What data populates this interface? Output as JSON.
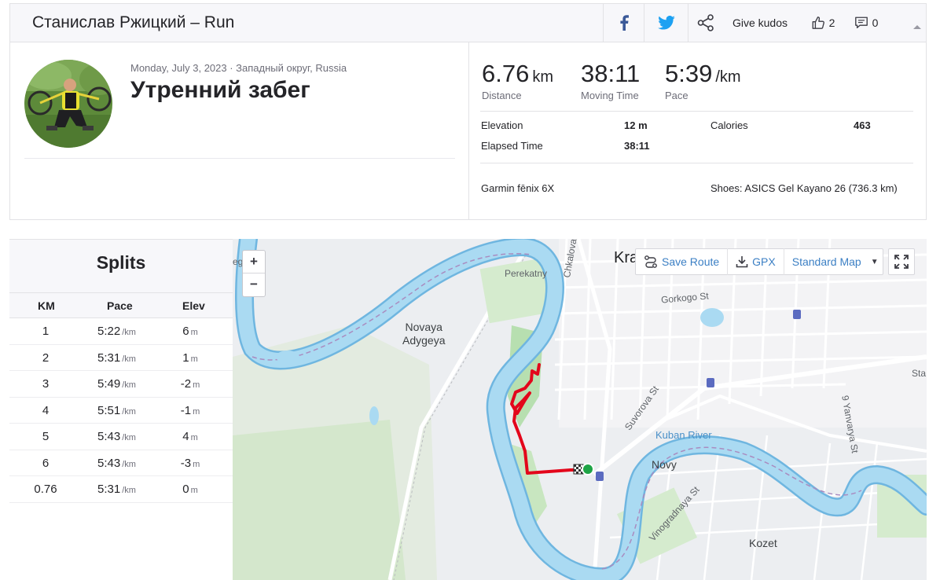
{
  "header": {
    "title": "Станислав Ржицкий – Run",
    "give_kudos": "Give kudos",
    "kudos_count": "2",
    "comments_count": "0",
    "icons": [
      "facebook-icon",
      "twitter-icon",
      "share-icon",
      "thumbs-up-icon",
      "comment-icon",
      "collapse-icon"
    ]
  },
  "activity": {
    "date_location": "Monday, July 3, 2023 · Западный округ, Russia",
    "title": "Утренний забег",
    "stats": {
      "distance": {
        "value": "6.76",
        "unit": "km",
        "label": "Distance"
      },
      "moving_time": {
        "value": "38:11",
        "label": "Moving Time"
      },
      "pace": {
        "value": "5:39",
        "unit": "/km",
        "label": "Pace"
      }
    },
    "details": {
      "elevation_label": "Elevation",
      "elevation_value": "12 m",
      "calories_label": "Calories",
      "calories_value": "463",
      "elapsed_label": "Elapsed Time",
      "elapsed_value": "38:11"
    },
    "device": "Garmin fēnix 6X",
    "shoes": "Shoes: ASICS Gel Kayano 26 (736.3 km)"
  },
  "splits": {
    "title": "Splits",
    "columns": [
      "KM",
      "Pace",
      "Elev"
    ],
    "pace_unit": "/km",
    "elev_unit": "m",
    "rows": [
      {
        "km": "1",
        "pace": "5:22",
        "elev": "6"
      },
      {
        "km": "2",
        "pace": "5:31",
        "elev": "1"
      },
      {
        "km": "3",
        "pace": "5:49",
        "elev": "-2"
      },
      {
        "km": "4",
        "pace": "5:51",
        "elev": "-1"
      },
      {
        "km": "5",
        "pace": "5:43",
        "elev": "4"
      },
      {
        "km": "6",
        "pace": "5:43",
        "elev": "-3"
      },
      {
        "km": "0.76",
        "pace": "5:31",
        "elev": "0"
      }
    ]
  },
  "map": {
    "zoom_in": "+",
    "zoom_out": "−",
    "save_route": "Save Route",
    "gpx": "GPX",
    "map_type": "Standard Map",
    "labels": {
      "perekatny": "Perekatny",
      "chkalova": "Chkalova",
      "kra": "Kra",
      "gorkogo": "Gorkogo St",
      "novaya_adygeya": "Novaya\nAdygeya",
      "suvorova": "Suvorova St",
      "kuban_river": "Kuban River",
      "novy": "Novy",
      "vinogradnaya": "Vinogradnaya St",
      "kozet": "Kozet",
      "yanvarya": "9 Yanvarya St",
      "sta": "Sta",
      "edge_left": "ego"
    },
    "colors": {
      "water": "#aadaf2",
      "river_outline": "#6fb6e0",
      "park": "#c8e6c0",
      "route": "#e3061b",
      "roads": "#ffffff"
    }
  }
}
